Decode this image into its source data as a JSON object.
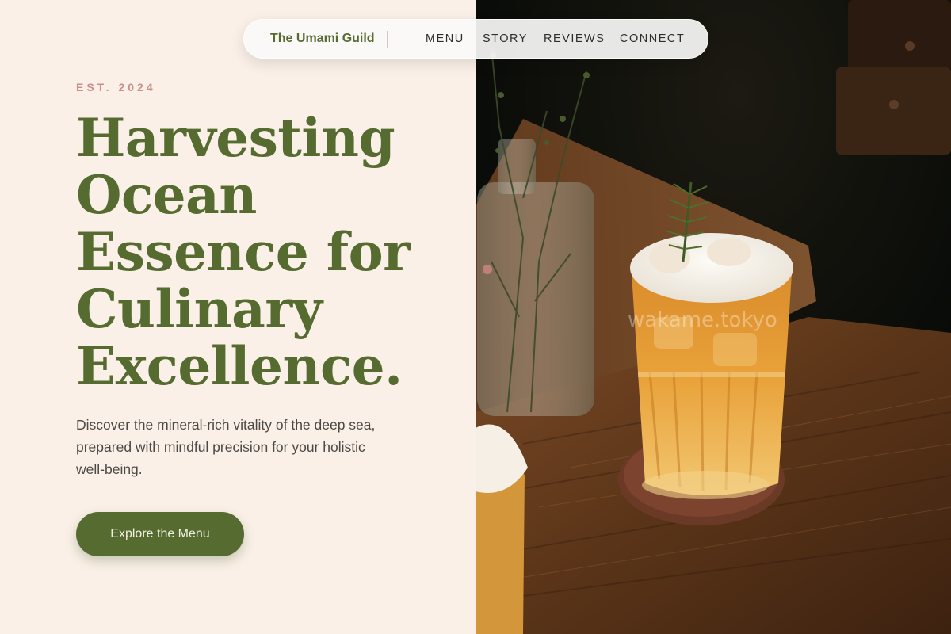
{
  "brand": {
    "name": "The Umami Guild"
  },
  "nav": {
    "items": [
      "MENU",
      "STORY",
      "REVIEWS",
      "CONNECT"
    ]
  },
  "hero": {
    "eyebrow": "EST. 2024",
    "headline_lines": [
      "Harvesting",
      "Ocean",
      "Essence for",
      "Culinary",
      "Excellence."
    ],
    "description": "Discover the mineral-rich vitality of the deep sea, prepared with mindful precision for your holistic well-being.",
    "cta_label": "Explore the Menu"
  },
  "photo": {
    "watermark": "wakame.tokyo",
    "subject": "iced amber tea with rosemary on a wooden table"
  },
  "colors": {
    "background": "#faf0e7",
    "accent": "#556b30",
    "eyebrow": "#c9908a",
    "body_text": "#4b4845"
  }
}
